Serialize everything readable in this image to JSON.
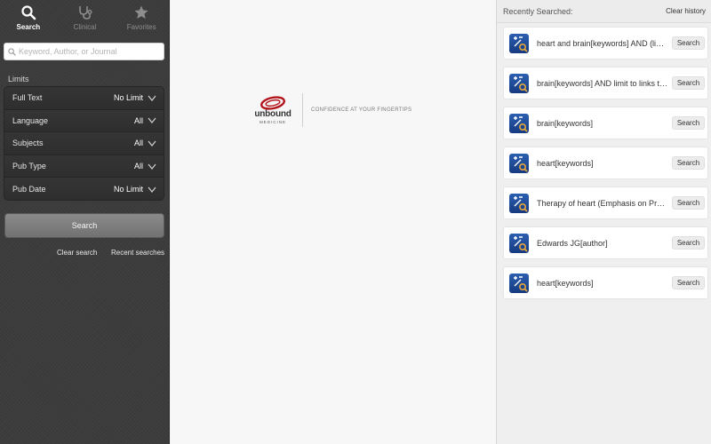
{
  "tabs": [
    {
      "label": "Search",
      "icon": "search-icon",
      "active": true
    },
    {
      "label": "Clinical",
      "icon": "stethoscope-icon",
      "active": false
    },
    {
      "label": "Favorites",
      "icon": "star-icon",
      "active": false
    }
  ],
  "search": {
    "placeholder": "Keyword, Author, or Journal",
    "value": ""
  },
  "limits": {
    "heading": "Limits",
    "rows": [
      {
        "label": "Full Text",
        "value": "No Limit"
      },
      {
        "label": "Language",
        "value": "All"
      },
      {
        "label": "Subjects",
        "value": "All"
      },
      {
        "label": "Pub Type",
        "value": "All"
      },
      {
        "label": "Pub Date",
        "value": "No Limit"
      }
    ]
  },
  "actions": {
    "search_label": "Search",
    "clear_search_label": "Clear search",
    "recent_searches_label": "Recent searches"
  },
  "branding": {
    "logo_word": "unbound",
    "logo_sub": "MEDICINE",
    "tagline": "CONFIDENCE AT YOUR FINGERTIPS",
    "brand_color": "#b3151c"
  },
  "history": {
    "title": "Recently Searched:",
    "clear_label": "Clear history",
    "item_button_label": "Search",
    "items": [
      {
        "text": "heart and brain[keywords] AND (limit to links to full text)"
      },
      {
        "text": "brain[keywords] AND limit to links to full text"
      },
      {
        "text": "brain[keywords]"
      },
      {
        "text": "heart[keywords]"
      },
      {
        "text": "Therapy of heart (Emphasis on Prevention)"
      },
      {
        "text": "Edwards JG[author]"
      },
      {
        "text": "heart[keywords]"
      }
    ]
  },
  "colors": {
    "sidebar_bg": "#3c3c3c",
    "app_icon": "#1f4c9a"
  }
}
